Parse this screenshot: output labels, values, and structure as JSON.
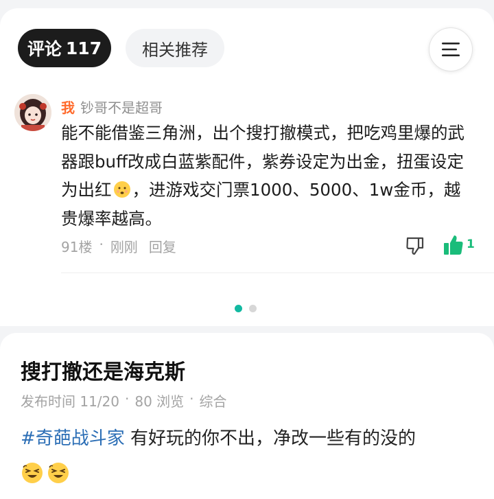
{
  "tabs": {
    "comments_label": "评论",
    "comments_count": "117",
    "related_label": "相关推荐"
  },
  "comment": {
    "author": "我",
    "reply_to": "钞哥不是超哥",
    "text_part1": "能不能借鉴三角洲，出个搜打撤模式，把吃鸡里爆的武器跟buff改成白蓝紫配件，紫券设定为出金，扭蛋设定为出红",
    "text_part2": "，进游戏交门票1000、5000、1w金币，越贵爆率越高。",
    "floor": "91楼",
    "separator": "·",
    "time": "刚刚",
    "reply_label": "回复",
    "like_count": "1"
  },
  "pager": {
    "total": 2,
    "active": 1
  },
  "post": {
    "title": "搜打撤还是海克斯",
    "publish_label": "发布时间 11/20",
    "sep1": "·",
    "views": "80 浏览",
    "sep2": "·",
    "category": "综合",
    "hashtag": "#奇葩战斗家",
    "body": " 有好玩的你不出，净改一些有的没的"
  },
  "icons": {
    "menu": "hamburger-menu-icon",
    "dislike": "thumbs-down-icon",
    "like": "thumbs-up-icon",
    "inline_emoji": "smirk-emoji",
    "trailing_emoji": "squint-laugh-emoji"
  },
  "colors": {
    "author": "#ff6a2b",
    "like": "#1abc7a",
    "active_dot": "#12b9a1",
    "hashtag": "#2a6db5"
  }
}
